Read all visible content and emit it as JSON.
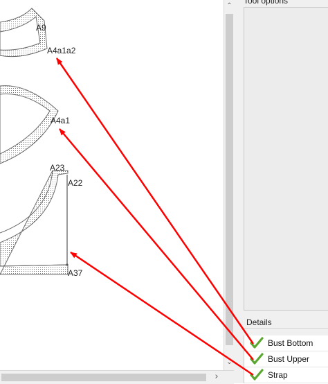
{
  "canvas": {
    "points": {
      "a9": "A9",
      "a4a1a2": "A4a1a2",
      "a4a1": "A4a1",
      "a23": "A23",
      "a22": "A22",
      "a37": "A37"
    }
  },
  "scrollbars": {
    "up_arrow": "⌃",
    "down_arrow": "⌄",
    "right_arrow": "›"
  },
  "tool_options": {
    "title": "Tool options"
  },
  "details": {
    "title": "Details",
    "items": [
      {
        "label": "Bust Bottom",
        "checked": true
      },
      {
        "label": "Bust Upper",
        "checked": true
      },
      {
        "label": "Strap",
        "checked": true
      }
    ]
  },
  "colors": {
    "arrow": "#ff0000",
    "check": "#5aa832"
  }
}
